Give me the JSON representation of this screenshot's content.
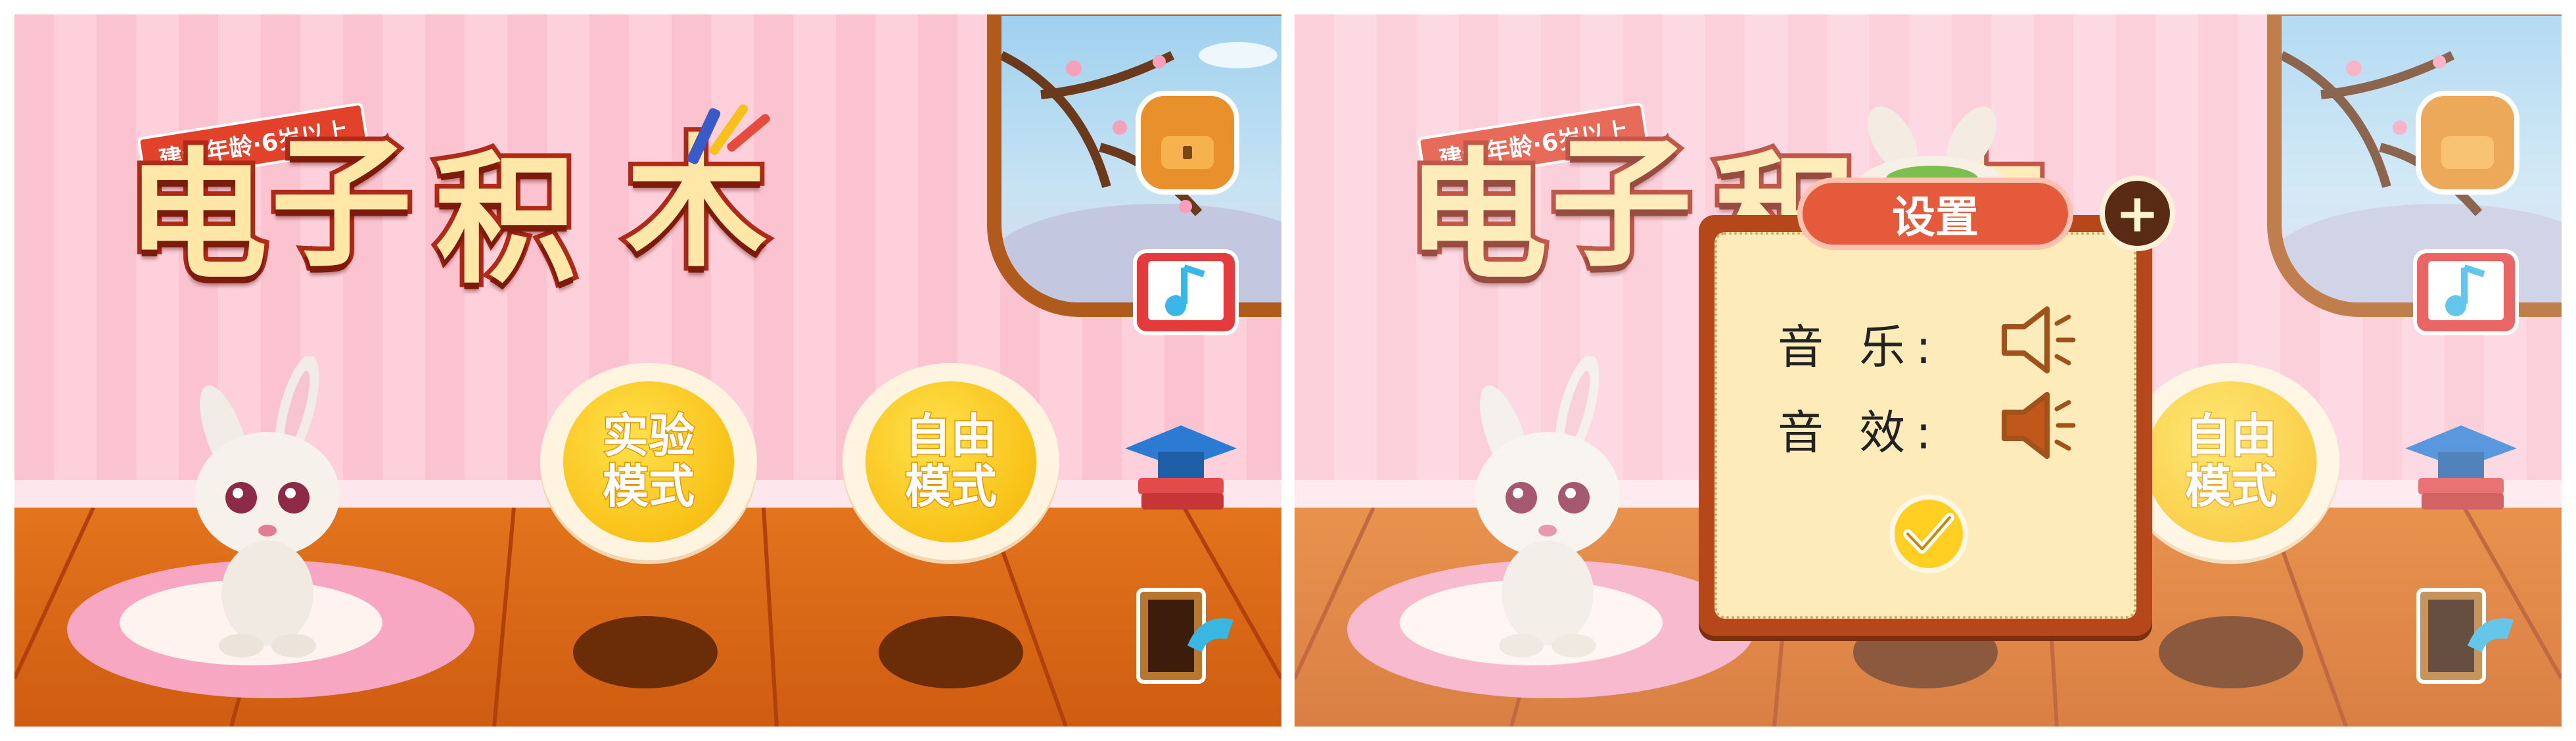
{
  "title": {
    "chars": [
      "电",
      "子",
      "积",
      "木"
    ],
    "age_ribbon": "建议年龄·6岁以上"
  },
  "modes": [
    {
      "line1": "实验",
      "line2": "模式"
    },
    {
      "line1": "自由",
      "line2": "模式"
    }
  ],
  "side_icons": [
    "backpack-icon",
    "music-book-icon",
    "graduation-books-icon",
    "exit-door-icon"
  ],
  "settings": {
    "title": "设置",
    "close_label": "+",
    "music_label": "音  乐:",
    "sound_label": "音  效:",
    "music_icon": "speaker-off-icon",
    "sound_icon": "speaker-on-icon"
  },
  "colors": {
    "wall": "#fbc3d0",
    "floor": "#e3741c",
    "button_yellow": "#ffd021",
    "dialog_frame": "#b5471a",
    "dialog_title": "#e55a3a"
  }
}
